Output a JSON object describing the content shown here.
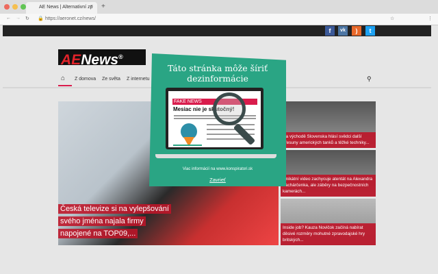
{
  "browser": {
    "tab_title": "AE News | Alternativní zp",
    "url": "https://aeronet.cz/news/"
  },
  "social": [
    "f",
    "vk",
    "rss",
    "tw"
  ],
  "site": {
    "logo": "AENews®",
    "nav": [
      "Z domova",
      "Ze světa",
      "Z internetu"
    ]
  },
  "hero": {
    "caption": "Česká televize si na vylepšování svého jména najala firmy napojené na TOP09,..."
  },
  "side": [
    {
      "caption": "Na východě Slovenska hlásí svědci další přesuny amerických tanků a těžké techniky..."
    },
    {
      "caption": "Unikátní video zachycuje atentát na Alexandra Zachárčenka, ale záběry na bezpečnostních kamerách..."
    },
    {
      "caption": "Inside job? Kauza Novičok začíná nabírat děsivé rozměry mohutné zpravodajské hry britských..."
    }
  ],
  "popup": {
    "title": "Táto stránka môže šíriť dezinformácie",
    "fake_label": "FAKE NEWS",
    "headline": "Mesiac nie je skutočný!",
    "more": "Viac informácií na www.konspiratori.sk",
    "close": "Zavrieť"
  },
  "colors": {
    "popup": "#2aa584",
    "accent": "#d91c4c"
  }
}
